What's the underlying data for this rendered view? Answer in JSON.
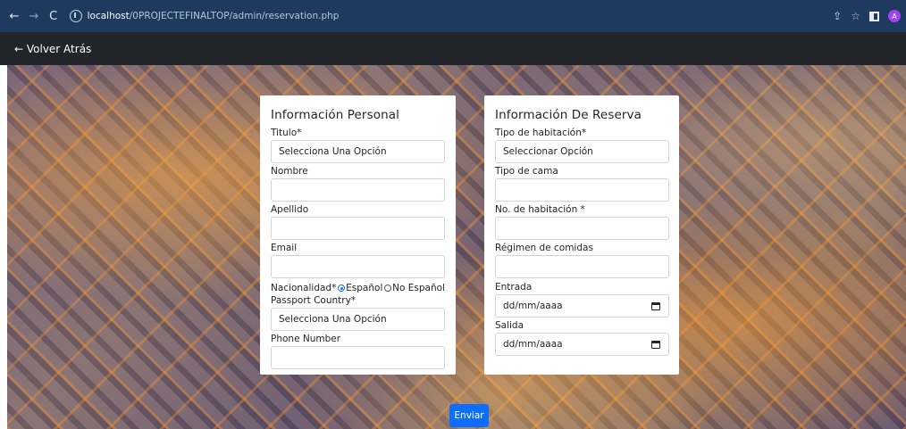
{
  "browser": {
    "url_host": "localhost",
    "url_path": "/0PROJECTEFINALTOP/admin/reservation.php",
    "back_icon": "arrow-left-icon",
    "forward_icon": "arrow-right-icon",
    "reload_icon": "reload-icon",
    "profile_initial": "A"
  },
  "app_bar": {
    "back_label": "← Volver Atrás"
  },
  "personal": {
    "title": "Información Personal",
    "titulo_label": "Titulo*",
    "titulo_value": "Selecciona Una Opción",
    "nombre_label": "Nombre",
    "apellido_label": "Apellido",
    "email_label": "Email",
    "nacionalidad_label": "Nacionalidad*",
    "nacionalidad_opt1": "Español",
    "nacionalidad_opt2": "No Español",
    "passport_label": "Passport Country*",
    "passport_value": "Selecciona Una Opción",
    "phone_label": "Phone Number"
  },
  "reserva": {
    "title": "Información De Reserva",
    "tipo_hab_label": "Tipo de habitación*",
    "tipo_hab_value": "Seleccionar Opción",
    "tipo_cama_label": "Tipo de cama",
    "no_hab_label": "No. de habitación *",
    "regimen_label": "Régimen de comidas",
    "entrada_label": "Entrada",
    "entrada_placeholder": "dd/mm/aaaa",
    "salida_label": "Salida",
    "salida_placeholder": "dd/mm/aaaa"
  },
  "submit_label": "Enviar",
  "colors": {
    "primary": "#0d6efd",
    "browser_bar": "#1f3a5f",
    "app_bar": "#212529"
  }
}
